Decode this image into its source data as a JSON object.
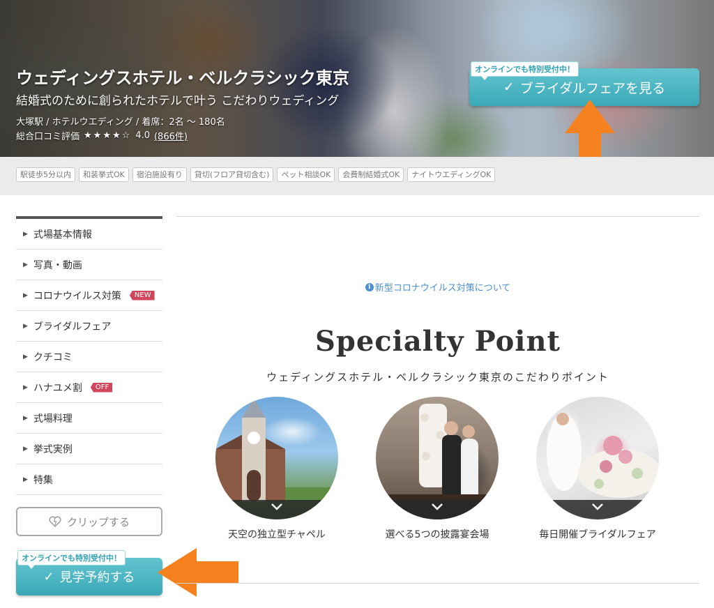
{
  "hero": {
    "title": "ウェディングスホテル・ベルクラシック東京",
    "subtitle": "結婚式のために創られたホテルで叶う こだわりウェディング",
    "meta": "大塚駅 / ホテルウエディング / 着席：2名 ～ 180名",
    "rating_label": "総合口コミ評価",
    "stars": "★★★★☆",
    "rating_value": "4.0",
    "review_count": "(866件)"
  },
  "cta": {
    "badge": "オンラインでも特別受付中！",
    "check_icon": "✓",
    "fair_label": "ブライダルフェアを見る",
    "visit_label": "見学予約する",
    "clip_label": "クリップする"
  },
  "tags": [
    "駅徒歩5分以内",
    "和装挙式OK",
    "宿泊施設有り",
    "貸切(フロア貸切含む)",
    "ペット相談OK",
    "会費制結婚式OK",
    "ナイトウエディングOK"
  ],
  "sidebar": {
    "items": [
      {
        "label": "式場基本情報"
      },
      {
        "label": "写真・動画"
      },
      {
        "label": "コロナウイルス対策",
        "badge": "NEW"
      },
      {
        "label": "ブライダルフェア"
      },
      {
        "label": "クチコミ"
      },
      {
        "label": "ハナユメ割",
        "badge": "OFF"
      },
      {
        "label": "式場料理"
      },
      {
        "label": "挙式実例"
      },
      {
        "label": "特集"
      }
    ]
  },
  "main": {
    "covid_link": "新型コロナウイルス対策について",
    "specialty_title": "Specialty Point",
    "specialty_subtitle": "ウェディングスホテル・ベルクラシック東京のこだわりポイント",
    "points": [
      {
        "label": "天空の独立型チャペル"
      },
      {
        "label": "選べる5つの披露宴会場"
      },
      {
        "label": "毎日開催ブライダルフェア"
      }
    ]
  },
  "colors": {
    "accent": "#3aa9b7",
    "arrow": "#f5821f",
    "badge_red": "#d0465a",
    "link": "#4b8fcc"
  }
}
